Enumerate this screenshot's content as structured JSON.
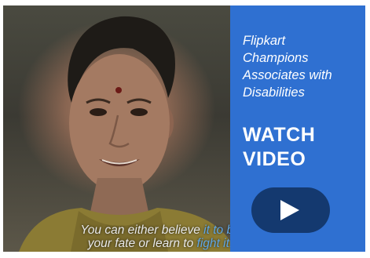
{
  "promo": {
    "title_lines": [
      "Flipkart",
      "Champions",
      "Associates with",
      "Disabilities"
    ],
    "cta_lines": [
      "WATCH",
      "VIDEO"
    ],
    "play_icon": "play-icon"
  },
  "video": {
    "caption_part1": "You can either believe",
    "caption_part1_fade": " it to be",
    "caption_part2": "your fate or learn to",
    "caption_part2_fade": " fight it."
  },
  "colors": {
    "panel": "#2f70d1",
    "play_button": "#14396f",
    "caption_accent": "#5fa6e6"
  }
}
